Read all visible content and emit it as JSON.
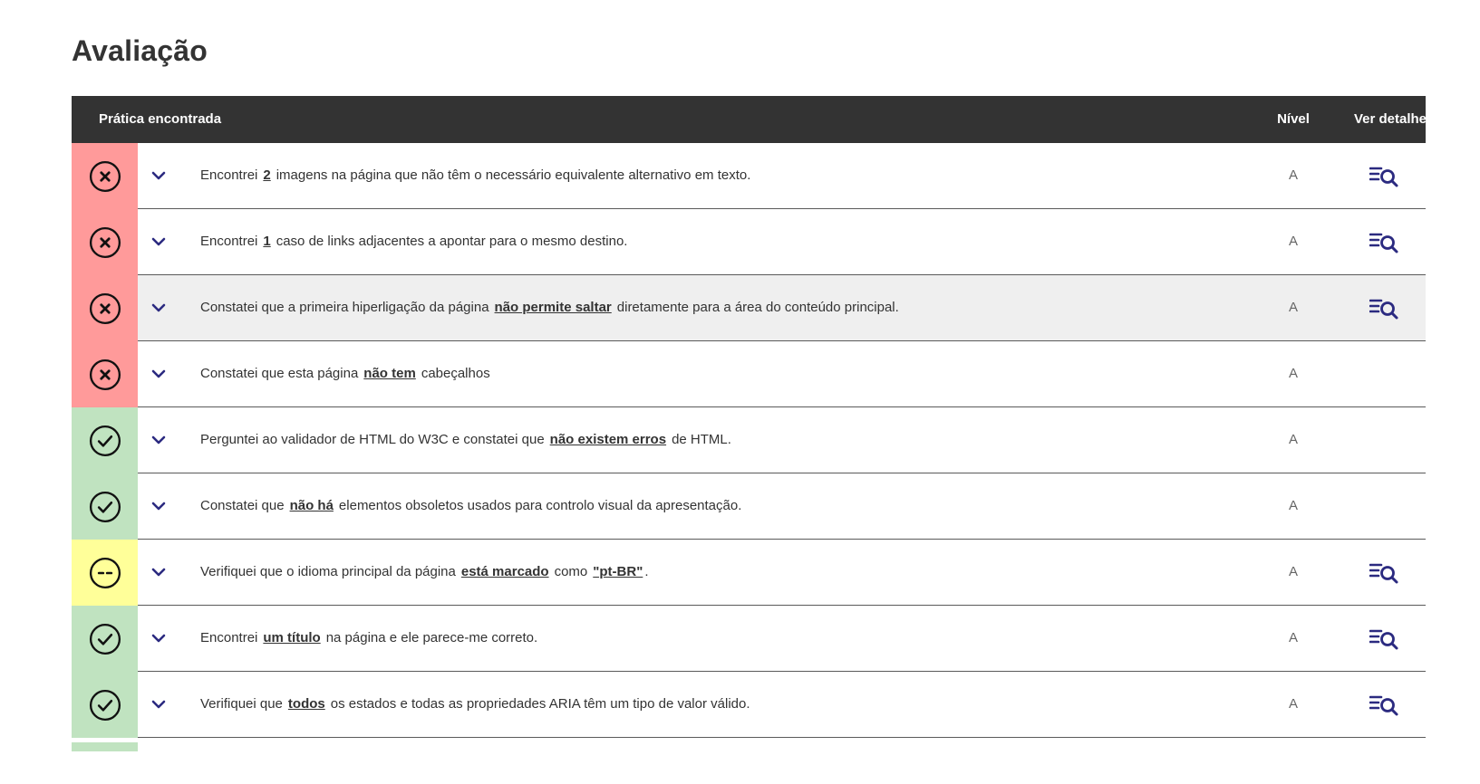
{
  "page": {
    "title": "Avaliação"
  },
  "colors": {
    "error": "#ff9a9a",
    "ok": "#c0e3c0",
    "warning": "#ffff99",
    "accent": "#2b2a80",
    "header_bg": "#333333"
  },
  "table": {
    "headers": {
      "practice": "Prática encontrada",
      "level": "Nível",
      "detail": "Ver detalhe"
    },
    "rows": [
      {
        "status": "error",
        "status_icon": "x-circle-icon",
        "pre": "Encontrei",
        "link": "2",
        "post": "imagens na página que não têm o necessário equivalente alternativo em texto.",
        "link2": null,
        "post2": "",
        "level": "A",
        "has_detail": true
      },
      {
        "status": "error",
        "status_icon": "x-circle-icon",
        "pre": "Encontrei",
        "link": "1",
        "post": "caso de links adjacentes a apontar para o mesmo destino.",
        "link2": null,
        "post2": "",
        "level": "A",
        "has_detail": true
      },
      {
        "status": "error",
        "status_icon": "x-circle-icon",
        "pre": "Constatei que a primeira hiperligação da página",
        "link": "não permite saltar",
        "post": "diretamente para a área do conteúdo principal.",
        "link2": null,
        "post2": "",
        "level": "A",
        "has_detail": true,
        "highlighted": true
      },
      {
        "status": "error",
        "status_icon": "x-circle-icon",
        "pre": "Constatei que esta página",
        "link": "não tem",
        "post": "cabeçalhos",
        "link2": null,
        "post2": "",
        "level": "A",
        "has_detail": false
      },
      {
        "status": "ok",
        "status_icon": "check-circle-icon",
        "pre": "Perguntei ao validador de HTML do W3C e constatei que",
        "link": "não existem erros",
        "post": "de HTML.",
        "link2": null,
        "post2": "",
        "level": "A",
        "has_detail": false
      },
      {
        "status": "ok",
        "status_icon": "check-circle-icon",
        "pre": "Constatei que",
        "link": "não há",
        "post": "elementos obsoletos usados para controlo visual da apresentação.",
        "link2": null,
        "post2": "",
        "level": "A",
        "has_detail": false
      },
      {
        "status": "warn",
        "status_icon": "dash-circle-icon",
        "pre": "Verifiquei que o idioma principal da página",
        "link": "está marcado",
        "post": "como",
        "link2": "\"pt-BR\"",
        "post2": ".",
        "level": "A",
        "has_detail": true
      },
      {
        "status": "ok",
        "status_icon": "check-circle-icon",
        "pre": "Encontrei",
        "link": "um título",
        "post": "na página e ele parece-me correto.",
        "link2": null,
        "post2": "",
        "level": "A",
        "has_detail": true
      },
      {
        "status": "ok",
        "status_icon": "check-circle-icon",
        "pre": "Verifiquei que",
        "link": "todos",
        "post": "os estados e todas as propriedades ARIA têm um tipo de valor válido.",
        "link2": null,
        "post2": "",
        "level": "A",
        "has_detail": true
      }
    ]
  }
}
